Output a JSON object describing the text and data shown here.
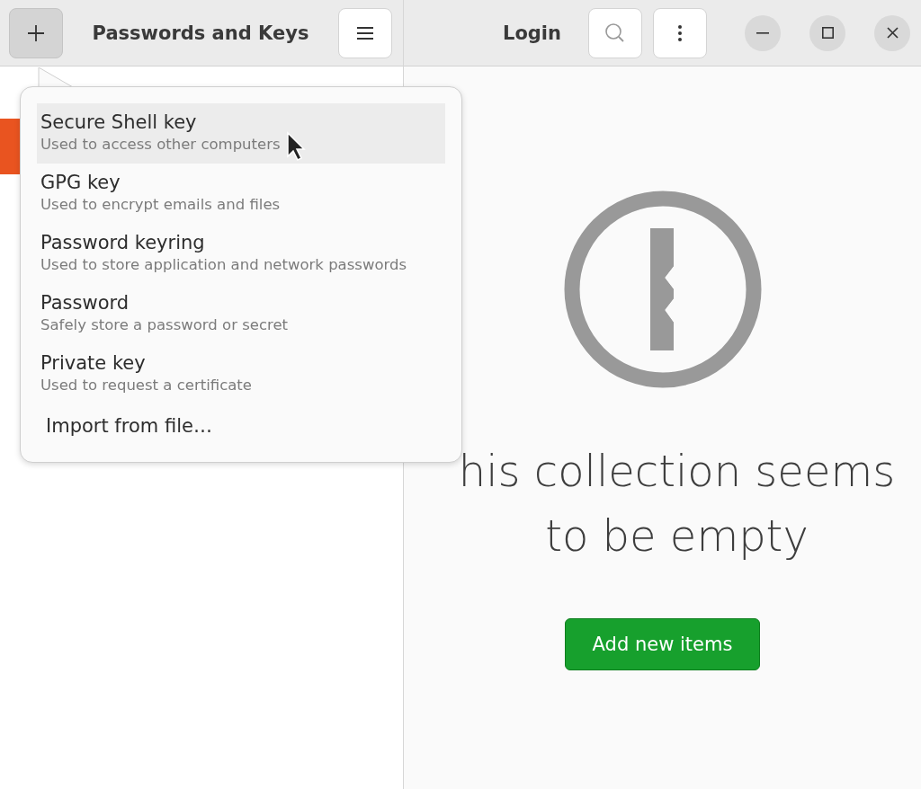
{
  "sidebar_header": {
    "title": "Passwords and Keys"
  },
  "sidebar": {
    "sections": [
      {
        "items": [
          {
            "selected": true
          }
        ]
      }
    ]
  },
  "content_header": {
    "title": "Login"
  },
  "add_menu": {
    "items": [
      {
        "kind": "entry",
        "title": "Secure Shell key",
        "subtitle": "Used to access other computers",
        "selected": true
      },
      {
        "kind": "entry",
        "title": "GPG key",
        "subtitle": "Used to encrypt emails and files",
        "selected": false
      },
      {
        "kind": "entry",
        "title": "Password keyring",
        "subtitle": "Used to store application and network passwords",
        "selected": false
      },
      {
        "kind": "entry",
        "title": "Password",
        "subtitle": "Safely store a password or secret",
        "selected": false
      },
      {
        "kind": "entry",
        "title": "Private key",
        "subtitle": "Used to request a certificate",
        "selected": false
      },
      {
        "kind": "action",
        "title": "Import from file…",
        "selected": false
      }
    ]
  },
  "empty_state": {
    "message": "his collection seems to be empty",
    "button": "Add new items"
  }
}
